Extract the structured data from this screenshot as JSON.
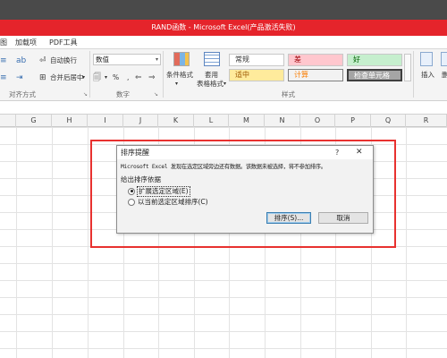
{
  "window": {
    "title": "RAND函数 - Microsoft Excel(产品激活失败)"
  },
  "ribbon_tabs": [
    "图",
    "加载项",
    "PDF工具"
  ],
  "ribbon": {
    "alignment": {
      "wrap_text": "自动换行",
      "merge_center": "合并后居中",
      "group": "对齐方式"
    },
    "number": {
      "format": "数值",
      "percent": "%",
      "comma": ",",
      "group": "数字"
    },
    "styles": {
      "conditional_format": "条件格式",
      "table_format": [
        "套用",
        "表格格式"
      ],
      "cell_styles": [
        {
          "label": "常规",
          "kind": "normal"
        },
        {
          "label": "差",
          "kind": "bad"
        },
        {
          "label": "好",
          "kind": "good"
        },
        {
          "label": "适中",
          "kind": "neutral"
        },
        {
          "label": "计算",
          "kind": "calc"
        },
        {
          "label": "检查单元格",
          "kind": "check"
        }
      ],
      "group": "样式"
    },
    "cells": {
      "insert": "插入",
      "delete": "删"
    }
  },
  "columns": [
    "G",
    "H",
    "I",
    "J",
    "K",
    "L",
    "M",
    "N",
    "O",
    "P",
    "Q",
    "R"
  ],
  "dialog": {
    "title": "排序提醒",
    "help": "?",
    "close": "✕",
    "message": "Microsoft Excel 发现在选定区域旁边还有数据。该数据未被选择，将不参加排序。",
    "subhead": "给出排序依据",
    "options": [
      {
        "label": "扩展选定区域(E)",
        "checked": true
      },
      {
        "label": "以当前选定区域排序(C)",
        "checked": false
      }
    ],
    "sort_button": "排序(S)...",
    "cancel_button": "取消"
  },
  "colors": {
    "title_bar": "#e5242b",
    "highlight_border": "#e8312f"
  }
}
